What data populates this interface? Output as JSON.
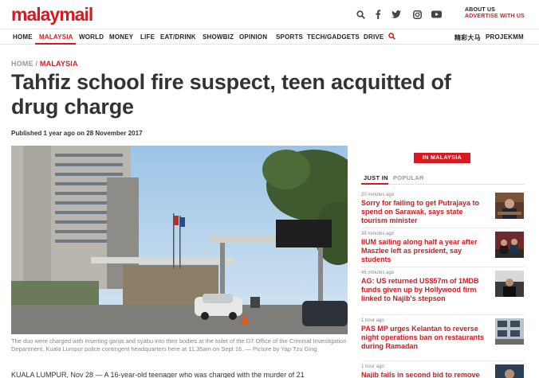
{
  "header": {
    "logo_text": "malaymail",
    "about_line1": "ABOUT US",
    "about_line2": "ADVERTISE WITH US",
    "social_icons": [
      "search-icon",
      "facebook-icon",
      "twitter-icon",
      "instagram-icon",
      "youtube-icon"
    ]
  },
  "nav": {
    "items": [
      "HOME",
      "MALAYSIA",
      "WORLD",
      "MONEY",
      "LIFE",
      "EAT/DRINK",
      "SHOWBIZ",
      "OPINION",
      "SPORTS",
      "TECH/GADGETS",
      "DRIVE"
    ],
    "active": "MALAYSIA",
    "right_items": [
      "精彩大马",
      "PROJEKMM"
    ]
  },
  "article": {
    "breadcrumb_home": "HOME",
    "breadcrumb_sep": " / ",
    "breadcrumb_current": "MALAYSIA",
    "title": "Tahfiz school fire suspect, teen acquitted of drug charge",
    "published": "Published 1 year ago on 28 November 2017",
    "caption": "The duo were charged with inserting ganja and syabu into their bodies at the toilet of the D7 Office of the Criminal Investigation Department, Kuala Lumpur police contingent headquarters here at 11.35am on Sept 16. — Picture by Yap Tzu Ging",
    "lead": "KUALA LUMPUR, Nov 28 — A 16-year-old teenager who was charged with the murder of 21"
  },
  "sidebar": {
    "section_label": "IN MALAYSIA",
    "tabs": [
      "JUST IN",
      "POPULAR"
    ],
    "active_tab": "JUST IN",
    "stories": [
      {
        "time": "20 minutes ago",
        "headline": "Sorry for failing to get Putrajaya to spend on Sarawak, says state tourism minister"
      },
      {
        "time": "38 minutes ago",
        "headline": "IIUM sailing along half a year after Maszlee left as president, say students"
      },
      {
        "time": "46 minutes ago",
        "headline": "AG: US returned US$57m of 1MDB funds given up by Hollywood firm linked to Najib's stepson"
      },
      {
        "time": "1 hour ago",
        "headline": "PAS MP urges Kelantan to reverse night operations ban on restaurants during Ramadan"
      },
      {
        "time": "1 hour ago",
        "headline": "Najib fails in second bid to remove"
      }
    ]
  },
  "colors": {
    "brand_red": "#d71920",
    "text_dark": "#333333",
    "text_muted": "#888888"
  }
}
